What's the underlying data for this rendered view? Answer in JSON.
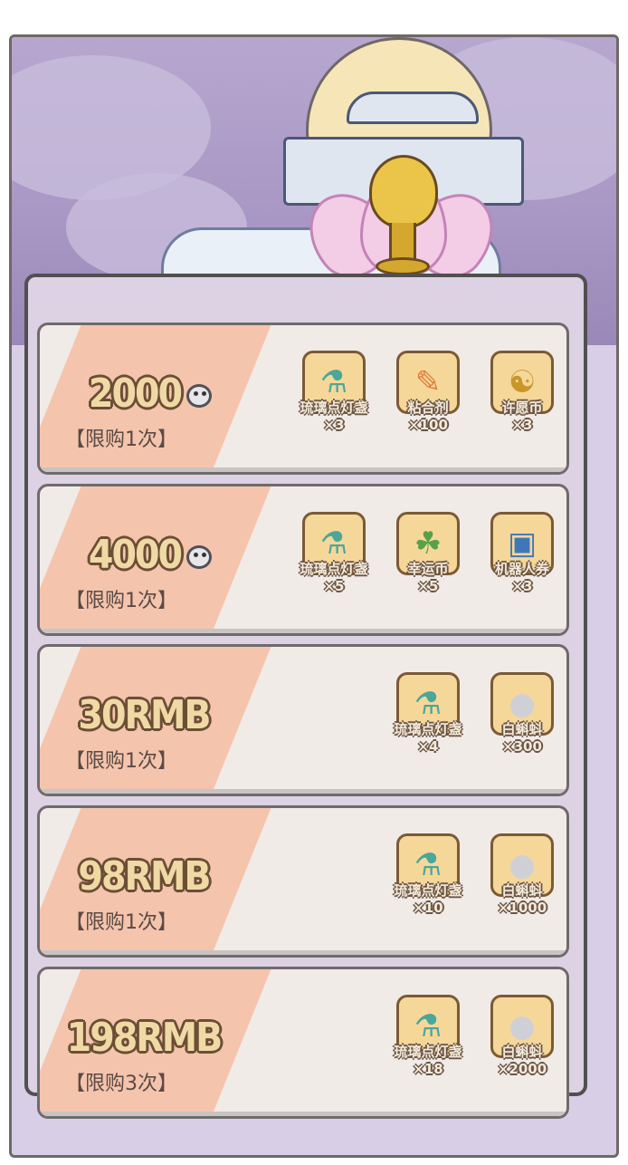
{
  "offers": [
    {
      "price": "2000",
      "currency_icon": "tadpole-icon",
      "limit": "【限购1次】",
      "items": [
        {
          "icon": "glass-lamp-icon",
          "name": "琉璃点灯盏",
          "qty": "×3"
        },
        {
          "icon": "glue-tube-icon",
          "name": "粘合剂",
          "qty": "×100"
        },
        {
          "icon": "wish-coin-icon",
          "name": "许愿币",
          "qty": "×3"
        }
      ]
    },
    {
      "price": "4000",
      "currency_icon": "tadpole-icon",
      "limit": "【限购1次】",
      "items": [
        {
          "icon": "glass-lamp-icon",
          "name": "琉璃点灯盏",
          "qty": "×5"
        },
        {
          "icon": "lucky-coin-icon",
          "name": "幸运币",
          "qty": "×5"
        },
        {
          "icon": "robot-ticket-icon",
          "name": "机器人券",
          "qty": "×3"
        }
      ]
    },
    {
      "price": "30RMB",
      "currency_icon": "",
      "limit": "【限购1次】",
      "items": [
        {
          "icon": "glass-lamp-icon",
          "name": "琉璃点灯盏",
          "qty": "×4"
        },
        {
          "icon": "white-tadpole-icon",
          "name": "白蝌蚪",
          "qty": "×300"
        }
      ]
    },
    {
      "price": "98RMB",
      "currency_icon": "",
      "limit": "【限购1次】",
      "items": [
        {
          "icon": "glass-lamp-icon",
          "name": "琉璃点灯盏",
          "qty": "×10"
        },
        {
          "icon": "white-tadpole-icon",
          "name": "白蝌蚪",
          "qty": "×1000"
        }
      ]
    },
    {
      "price": "198RMB",
      "currency_icon": "",
      "limit": "【限购3次】",
      "items": [
        {
          "icon": "glass-lamp-icon",
          "name": "琉璃点灯盏",
          "qty": "×18"
        },
        {
          "icon": "white-tadpole-icon",
          "name": "白蝌蚪",
          "qty": "×2000"
        }
      ]
    }
  ],
  "colors": {
    "card_bg": "#f1ebe7",
    "stripe": "#f5c4ad",
    "item_box": "#f6d79a",
    "price_fill": "#f1d9a6",
    "price_outline": "#6a4f35"
  }
}
